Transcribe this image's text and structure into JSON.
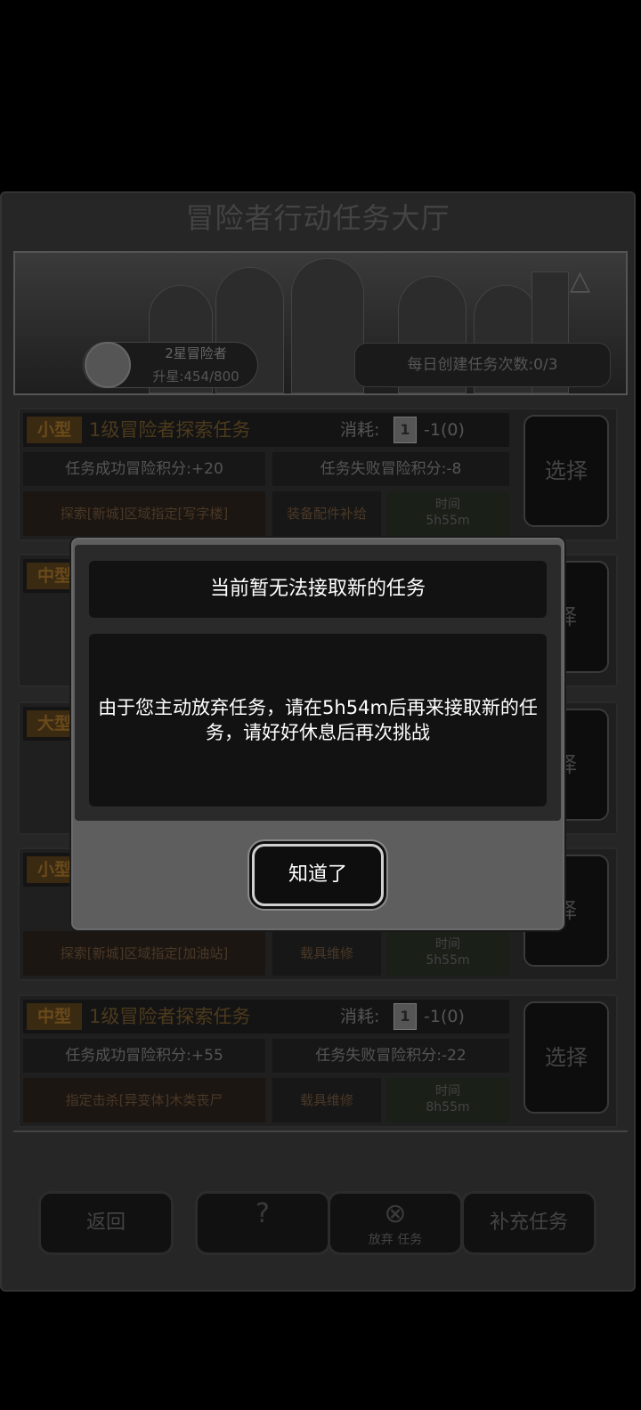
{
  "hall": {
    "title": "冒险者行动任务大厅",
    "player": {
      "rank": "2星冒险者",
      "star_progress": "升星:454/800"
    },
    "daily_create": "每日创建任务次数:0/3"
  },
  "tasks": [
    {
      "size": "小型",
      "name": "1级冒险者探索任务",
      "cost_label": "消耗:",
      "cost_icon": "1",
      "cost_value": "-1(0)",
      "success_score": "任务成功冒险积分:+20",
      "fail_score": "任务失败冒险积分:-8",
      "detail": "探索[新城]区域指定[写字楼]",
      "reward": "装备配件补给",
      "time_label": "时间",
      "time_value": "5h55m",
      "select": "选择"
    },
    {
      "size": "中型",
      "select": "择"
    },
    {
      "size": "大型",
      "select": "择"
    },
    {
      "size": "小型",
      "detail": "探索[新城]区域指定[加油站]",
      "reward": "载具维修",
      "time_label": "时间",
      "time_value": "5h55m",
      "select": "择"
    },
    {
      "size": "中型",
      "name": "1级冒险者探索任务",
      "cost_label": "消耗:",
      "cost_icon": "1",
      "cost_value": "-1(0)",
      "success_score": "任务成功冒险积分:+55",
      "fail_score": "任务失败冒险积分:-22",
      "detail": "指定击杀[异变体]木类丧尸",
      "reward": "载具维修",
      "time_label": "时间",
      "time_value": "8h55m",
      "select": "选择"
    }
  ],
  "bottom_bar": {
    "back": "返回",
    "help_icon": "question-map-icon",
    "abandon_icon": "close-circle-icon",
    "abandon": "放弃 任务",
    "refill": "补充任务"
  },
  "dialog": {
    "title": "当前暂无法接取新的任务",
    "message": "由于您主动放弃任务，请在5h54m后再来接取新的任务，请好好休息后再次挑战",
    "ok": "知道了"
  }
}
